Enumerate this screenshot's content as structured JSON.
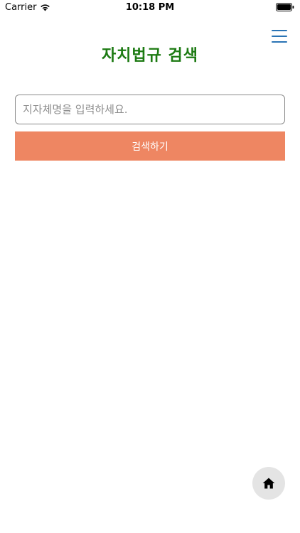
{
  "status_bar": {
    "carrier": "Carrier",
    "time": "10:18 PM"
  },
  "header": {
    "title": "자치법규 검색",
    "title_color": "#1c7a12",
    "menu_icon": "hamburger-menu-icon"
  },
  "search": {
    "placeholder": "지자체명을 입력하세요.",
    "value": "",
    "button_label": "검색하기",
    "button_color": "#ee8662"
  },
  "fab": {
    "icon": "home-icon"
  }
}
